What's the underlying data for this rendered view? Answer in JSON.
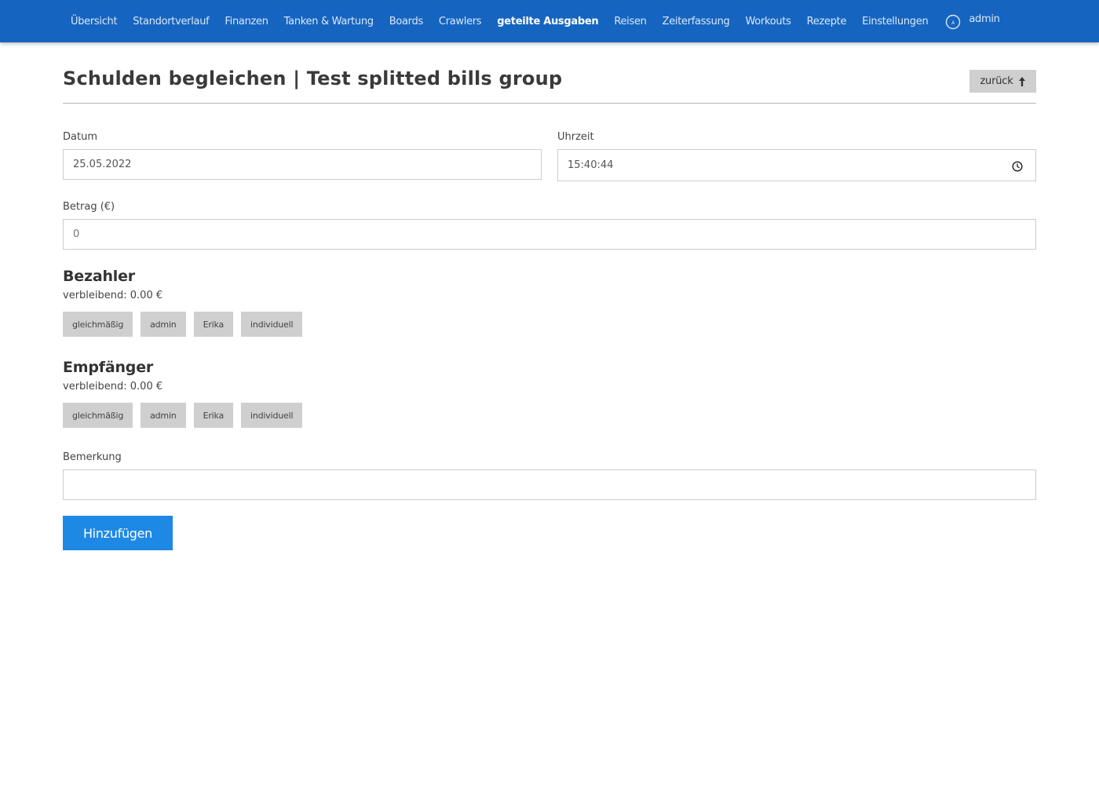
{
  "nav": {
    "items": [
      {
        "label": "Übersicht"
      },
      {
        "label": "Standortverlauf"
      },
      {
        "label": "Finanzen"
      },
      {
        "label": "Tanken & Wartung"
      },
      {
        "label": "Boards"
      },
      {
        "label": "Crawlers"
      },
      {
        "label": "geteilte Ausgaben",
        "active": true
      },
      {
        "label": "Reisen"
      },
      {
        "label": "Zeiterfassung"
      },
      {
        "label": "Workouts"
      },
      {
        "label": "Rezepte"
      },
      {
        "label": "Einstellungen"
      }
    ],
    "user": {
      "label": "admin",
      "icon": "avatar-icon"
    }
  },
  "header": {
    "title": "Schulden begleichen | Test splitted bills group",
    "back_label": "zurück",
    "back_icon": "arrow-up-icon"
  },
  "form": {
    "date": {
      "label": "Datum",
      "value": "25.05.2022"
    },
    "time": {
      "label": "Uhrzeit",
      "value": "15:40:44",
      "icon": "clock-icon"
    },
    "amount": {
      "label": "Betrag (€)",
      "placeholder": "0"
    },
    "payer": {
      "heading": "Bezahler",
      "remaining": "verbleibend: 0.00 €",
      "options": [
        "gleichmäßig",
        "admin",
        "Erika",
        "individuell"
      ]
    },
    "recipient": {
      "heading": "Empfänger",
      "remaining": "verbleibend: 0.00 €",
      "options": [
        "gleichmäßig",
        "admin",
        "Erika",
        "individuell"
      ]
    },
    "note": {
      "label": "Bemerkung",
      "value": ""
    },
    "submit_label": "Hinzufügen"
  },
  "colors": {
    "navbar": "#1565c0",
    "primary_button": "#1e88e5",
    "chip_bg": "#cfcfcf"
  }
}
